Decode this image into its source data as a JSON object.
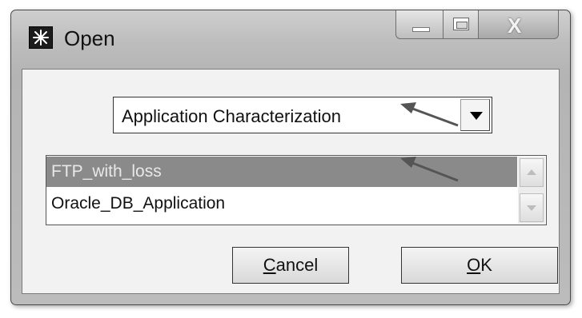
{
  "window": {
    "title": "Open",
    "icon": "star-burst-icon"
  },
  "caption_buttons": {
    "minimize_icon": "minimize-icon",
    "maximize_icon": "maximize-icon",
    "close_glyph": "X"
  },
  "dropdown": {
    "selected": "Application Characterization",
    "icon": "dropdown-arrow-icon"
  },
  "list": {
    "items": [
      {
        "label": "FTP_with_loss",
        "selected": true
      },
      {
        "label": "Oracle_DB_Application",
        "selected": false
      }
    ]
  },
  "buttons": {
    "cancel_mnemonic": "C",
    "cancel_rest": "ancel",
    "ok_mnemonic": "O",
    "ok_rest": "K"
  },
  "colors": {
    "selection": "#8a8a8a",
    "annotation_arrow": "#555555"
  }
}
